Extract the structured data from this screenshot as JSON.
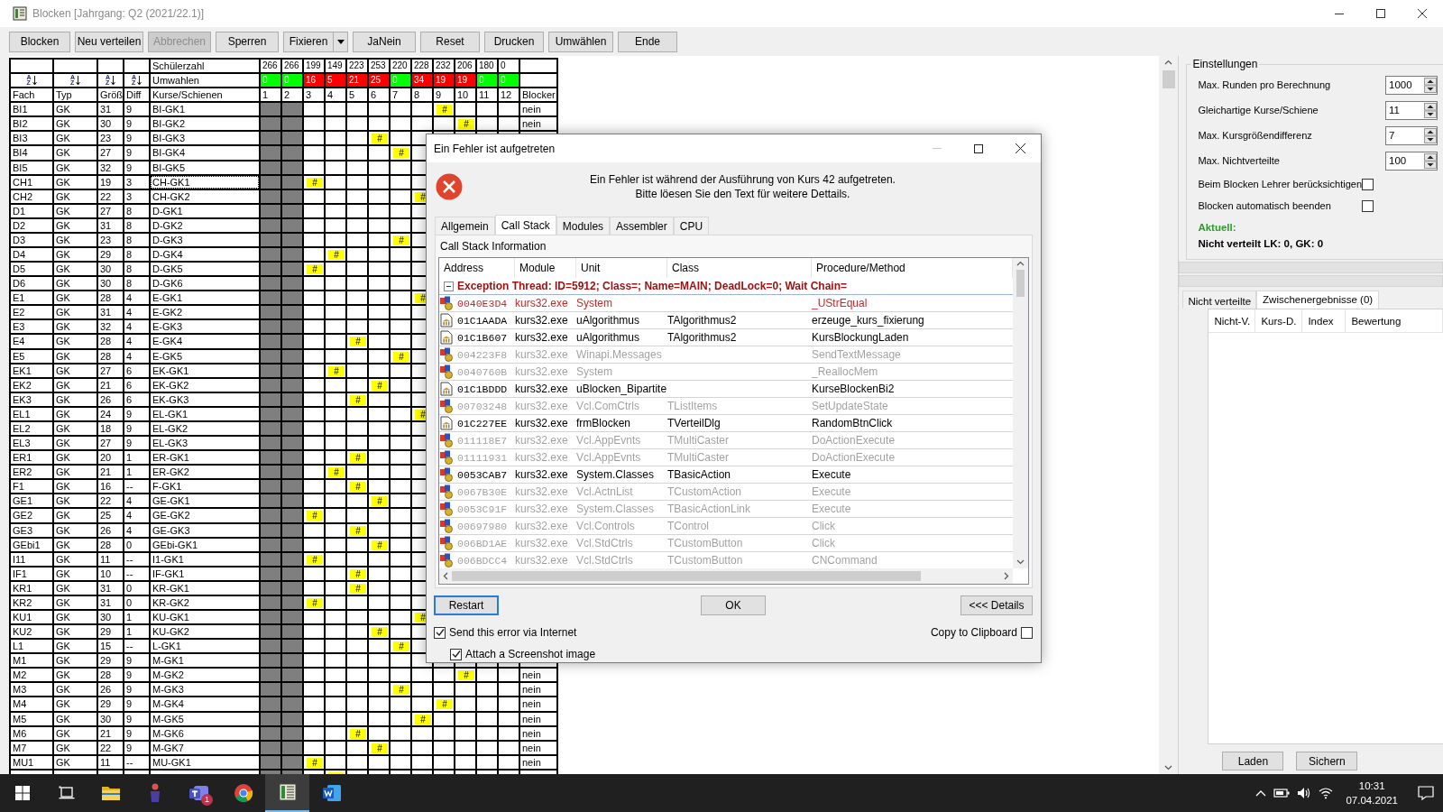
{
  "window": {
    "title": "Blocken [Jahrgang: Q2 (2021/22.1)]"
  },
  "toolbar": [
    {
      "label": "Blocken",
      "disabled": false,
      "kind": "plain"
    },
    {
      "label": "Neu verteilen",
      "disabled": false,
      "kind": "plain"
    },
    {
      "label": "Abbrechen",
      "disabled": true,
      "kind": "plain"
    },
    {
      "label": "Sperren",
      "disabled": false,
      "kind": "plain"
    },
    {
      "label": "Fixieren",
      "disabled": false,
      "kind": "split"
    },
    {
      "label": "JaNein",
      "disabled": false,
      "kind": "plain"
    },
    {
      "label": "Reset",
      "disabled": false,
      "kind": "plain"
    },
    {
      "label": "Drucken",
      "disabled": false,
      "kind": "plain"
    },
    {
      "label": "Umwählen",
      "disabled": false,
      "kind": "plain"
    },
    {
      "label": "Ende",
      "disabled": false,
      "kind": "plain"
    }
  ],
  "table": {
    "count_label": "Schülerzahl",
    "changes_label": "Umwahlen",
    "sort_buttons": [
      {
        "upper": "A",
        "lower": "Z"
      },
      {
        "upper": "A",
        "lower": "Z"
      },
      {
        "upper": "A",
        "lower": "Z"
      },
      {
        "upper": "A",
        "lower": "Z"
      }
    ],
    "headings": [
      "Fach",
      "Typ",
      "Größ",
      "Diff",
      "Kurse/Schienen"
    ],
    "blocker_heading": "Blocker",
    "columns": [
      {
        "label": "1",
        "count": "266",
        "changes": "0",
        "color": "#00ff00",
        "blocked": true
      },
      {
        "label": "2",
        "count": "266",
        "changes": "0",
        "color": "#00ff00",
        "blocked": true
      },
      {
        "label": "3",
        "count": "199",
        "changes": "16",
        "color": "#ff0000",
        "blocked": false
      },
      {
        "label": "4",
        "count": "149",
        "changes": "5",
        "color": "#ff0000",
        "blocked": false
      },
      {
        "label": "5",
        "count": "223",
        "changes": "21",
        "color": "#ff0000",
        "blocked": false
      },
      {
        "label": "6",
        "count": "253",
        "changes": "25",
        "color": "#ff0000",
        "blocked": false
      },
      {
        "label": "7",
        "count": "220",
        "changes": "0",
        "color": "#00ff00",
        "blocked": false
      },
      {
        "label": "8",
        "count": "228",
        "changes": "34",
        "color": "#ff0000",
        "blocked": false
      },
      {
        "label": "9",
        "count": "232",
        "changes": "19",
        "color": "#ff0000",
        "blocked": false
      },
      {
        "label": "10",
        "count": "206",
        "changes": "19",
        "color": "#ff0000",
        "blocked": false
      },
      {
        "label": "11",
        "count": "180",
        "changes": "0",
        "color": "#00ff00",
        "blocked": false
      },
      {
        "label": "12",
        "count": "0",
        "changes": "0",
        "color": "#00ff00",
        "blocked": false
      }
    ],
    "rows": [
      {
        "fach": "BI1",
        "typ": "GK",
        "size": "31",
        "diff": "9",
        "kurs": "BI-GK1",
        "focused": false,
        "placed": [
          false,
          false,
          false,
          false,
          false,
          false,
          false,
          false,
          true,
          false,
          false,
          false
        ],
        "mark": "#",
        "blocker": "nein"
      },
      {
        "fach": "BI2",
        "typ": "GK",
        "size": "30",
        "diff": "9",
        "kurs": "BI-GK2",
        "focused": false,
        "placed": [
          false,
          false,
          false,
          false,
          false,
          false,
          false,
          false,
          false,
          true,
          false,
          false
        ],
        "mark": "#",
        "blocker": "nein"
      },
      {
        "fach": "BI3",
        "typ": "GK",
        "size": "23",
        "diff": "9",
        "kurs": "BI-GK3",
        "focused": false,
        "placed": [
          false,
          false,
          false,
          false,
          false,
          true,
          false,
          false
        ],
        "mark": "#"
      },
      {
        "fach": "BI4",
        "typ": "GK",
        "size": "27",
        "diff": "9",
        "kurs": "BI-GK4",
        "focused": false,
        "placed": [
          false,
          false,
          false,
          false,
          false,
          false,
          true,
          false
        ],
        "mark": "#"
      },
      {
        "fach": "BI5",
        "typ": "GK",
        "size": "32",
        "diff": "9",
        "kurs": "BI-GK5",
        "focused": false,
        "placed": [
          false,
          false,
          false,
          false,
          false,
          false,
          false,
          false
        ]
      },
      {
        "fach": "CH1",
        "typ": "GK",
        "size": "19",
        "diff": "3",
        "kurs": "CH-GK1",
        "focused": true,
        "placed": [
          false,
          false,
          true,
          false,
          false,
          false,
          false,
          false
        ],
        "mark": "#"
      },
      {
        "fach": "CH2",
        "typ": "GK",
        "size": "22",
        "diff": "3",
        "kurs": "CH-GK2",
        "focused": false,
        "placed": [
          false,
          false,
          false,
          false,
          false,
          false,
          false,
          true
        ],
        "mark": "#"
      },
      {
        "fach": "D1",
        "typ": "GK",
        "size": "27",
        "diff": "8",
        "kurs": "D-GK1",
        "focused": false,
        "placed": [
          false,
          false,
          false,
          false,
          false,
          false,
          false,
          false
        ]
      },
      {
        "fach": "D2",
        "typ": "GK",
        "size": "31",
        "diff": "8",
        "kurs": "D-GK2",
        "focused": false,
        "placed": [
          false,
          false,
          false,
          false,
          false,
          false,
          false,
          false
        ]
      },
      {
        "fach": "D3",
        "typ": "GK",
        "size": "23",
        "diff": "8",
        "kurs": "D-GK3",
        "focused": false,
        "placed": [
          false,
          false,
          false,
          false,
          false,
          false,
          true,
          false
        ],
        "mark": "#"
      },
      {
        "fach": "D4",
        "typ": "GK",
        "size": "29",
        "diff": "8",
        "kurs": "D-GK4",
        "focused": false,
        "placed": [
          false,
          false,
          false,
          true,
          false,
          false,
          false,
          false
        ],
        "mark": "#"
      },
      {
        "fach": "D5",
        "typ": "GK",
        "size": "30",
        "diff": "8",
        "kurs": "D-GK5",
        "focused": false,
        "placed": [
          false,
          false,
          true,
          false,
          false,
          false,
          false,
          false
        ],
        "mark": "#"
      },
      {
        "fach": "D6",
        "typ": "GK",
        "size": "30",
        "diff": "8",
        "kurs": "D-GK6",
        "focused": false,
        "placed": [
          false,
          false,
          false,
          false,
          false,
          false,
          false,
          false
        ]
      },
      {
        "fach": "E1",
        "typ": "GK",
        "size": "28",
        "diff": "4",
        "kurs": "E-GK1",
        "focused": false,
        "placed": [
          false,
          false,
          false,
          false,
          false,
          false,
          false,
          true
        ],
        "mark": "#"
      },
      {
        "fach": "E2",
        "typ": "GK",
        "size": "31",
        "diff": "4",
        "kurs": "E-GK2",
        "focused": false,
        "placed": [
          false,
          false,
          false,
          false,
          false,
          false,
          false,
          false
        ]
      },
      {
        "fach": "E3",
        "typ": "GK",
        "size": "32",
        "diff": "4",
        "kurs": "E-GK3",
        "focused": false,
        "placed": [
          false,
          false,
          false,
          false,
          false,
          false,
          false,
          false
        ]
      },
      {
        "fach": "E4",
        "typ": "GK",
        "size": "28",
        "diff": "4",
        "kurs": "E-GK4",
        "focused": false,
        "placed": [
          false,
          false,
          false,
          false,
          true,
          false,
          false,
          false
        ],
        "mark": "#"
      },
      {
        "fach": "E5",
        "typ": "GK",
        "size": "28",
        "diff": "4",
        "kurs": "E-GK5",
        "focused": false,
        "placed": [
          false,
          false,
          false,
          false,
          false,
          false,
          true,
          false
        ],
        "mark": "#"
      },
      {
        "fach": "EK1",
        "typ": "GK",
        "size": "27",
        "diff": "6",
        "kurs": "EK-GK1",
        "focused": false,
        "placed": [
          false,
          false,
          false,
          true,
          false,
          false,
          false,
          false
        ],
        "mark": "#"
      },
      {
        "fach": "EK2",
        "typ": "GK",
        "size": "21",
        "diff": "6",
        "kurs": "EK-GK2",
        "focused": false,
        "placed": [
          false,
          false,
          false,
          false,
          false,
          true,
          false,
          false
        ],
        "mark": "#"
      },
      {
        "fach": "EK3",
        "typ": "GK",
        "size": "26",
        "diff": "6",
        "kurs": "EK-GK3",
        "focused": false,
        "placed": [
          false,
          false,
          false,
          false,
          true,
          false,
          false,
          false
        ],
        "mark": "#"
      },
      {
        "fach": "EL1",
        "typ": "GK",
        "size": "24",
        "diff": "9",
        "kurs": "EL-GK1",
        "focused": false,
        "placed": [
          false,
          false,
          false,
          false,
          false,
          false,
          false,
          true
        ],
        "mark": "#"
      },
      {
        "fach": "EL2",
        "typ": "GK",
        "size": "18",
        "diff": "9",
        "kurs": "EL-GK2",
        "focused": false,
        "placed": [
          false,
          false,
          false,
          false,
          false,
          false,
          false,
          false
        ]
      },
      {
        "fach": "EL3",
        "typ": "GK",
        "size": "27",
        "diff": "9",
        "kurs": "EL-GK3",
        "focused": false,
        "placed": [
          false,
          false,
          false,
          false,
          false,
          false,
          false,
          false
        ]
      },
      {
        "fach": "ER1",
        "typ": "GK",
        "size": "20",
        "diff": "1",
        "kurs": "ER-GK1",
        "focused": false,
        "placed": [
          false,
          false,
          false,
          false,
          true,
          false,
          false,
          false
        ],
        "mark": "#"
      },
      {
        "fach": "ER2",
        "typ": "GK",
        "size": "21",
        "diff": "1",
        "kurs": "ER-GK2",
        "focused": false,
        "placed": [
          false,
          false,
          false,
          true,
          false,
          false,
          false,
          false
        ],
        "mark": "#"
      },
      {
        "fach": "F1",
        "typ": "GK",
        "size": "16",
        "diff": "--",
        "kurs": "F-GK1",
        "focused": false,
        "placed": [
          false,
          false,
          false,
          false,
          true,
          false,
          false,
          false
        ],
        "mark": "#"
      },
      {
        "fach": "GE1",
        "typ": "GK",
        "size": "22",
        "diff": "4",
        "kurs": "GE-GK1",
        "focused": false,
        "placed": [
          false,
          false,
          false,
          false,
          false,
          true,
          false,
          false
        ],
        "mark": "#"
      },
      {
        "fach": "GE2",
        "typ": "GK",
        "size": "25",
        "diff": "4",
        "kurs": "GE-GK2",
        "focused": false,
        "placed": [
          false,
          false,
          true,
          false,
          false,
          false,
          false,
          false
        ],
        "mark": "#"
      },
      {
        "fach": "GE3",
        "typ": "GK",
        "size": "26",
        "diff": "4",
        "kurs": "GE-GK3",
        "focused": false,
        "placed": [
          false,
          false,
          false,
          false,
          true,
          false,
          false,
          false
        ],
        "mark": "#"
      },
      {
        "fach": "GEbi1",
        "typ": "GK",
        "size": "28",
        "diff": "0",
        "kurs": "GEbi-GK1",
        "focused": false,
        "placed": [
          false,
          false,
          false,
          false,
          false,
          true,
          false,
          false
        ],
        "mark": "#"
      },
      {
        "fach": "I11",
        "typ": "GK",
        "size": "11",
        "diff": "--",
        "kurs": "I1-GK1",
        "focused": false,
        "placed": [
          false,
          false,
          true,
          false,
          false,
          false,
          false,
          false
        ],
        "mark": "#"
      },
      {
        "fach": "IF1",
        "typ": "GK",
        "size": "10",
        "diff": "--",
        "kurs": "IF-GK1",
        "focused": false,
        "placed": [
          false,
          false,
          false,
          false,
          true,
          false,
          false,
          false
        ],
        "mark": "#"
      },
      {
        "fach": "KR1",
        "typ": "GK",
        "size": "31",
        "diff": "0",
        "kurs": "KR-GK1",
        "focused": false,
        "placed": [
          false,
          false,
          false,
          false,
          true,
          false,
          false,
          false
        ],
        "mark": "#"
      },
      {
        "fach": "KR2",
        "typ": "GK",
        "size": "31",
        "diff": "0",
        "kurs": "KR-GK2",
        "focused": false,
        "placed": [
          false,
          false,
          true,
          false,
          false,
          false,
          false,
          false
        ],
        "mark": "#"
      },
      {
        "fach": "KU1",
        "typ": "GK",
        "size": "30",
        "diff": "1",
        "kurs": "KU-GK1",
        "focused": false,
        "placed": [
          false,
          false,
          false,
          false,
          false,
          false,
          false,
          true
        ],
        "mark": "#"
      },
      {
        "fach": "KU2",
        "typ": "GK",
        "size": "29",
        "diff": "1",
        "kurs": "KU-GK2",
        "focused": false,
        "placed": [
          false,
          false,
          false,
          false,
          false,
          true,
          false,
          false
        ],
        "mark": "#"
      },
      {
        "fach": "L1",
        "typ": "GK",
        "size": "15",
        "diff": "--",
        "kurs": "L-GK1",
        "focused": false,
        "placed": [
          false,
          false,
          false,
          false,
          false,
          false,
          true,
          false
        ],
        "mark": "#"
      },
      {
        "fach": "M1",
        "typ": "GK",
        "size": "29",
        "diff": "9",
        "kurs": "M-GK1",
        "focused": false,
        "placed": [
          false,
          false,
          false,
          false,
          false,
          false,
          false,
          false
        ]
      },
      {
        "fach": "M2",
        "typ": "GK",
        "size": "28",
        "diff": "9",
        "kurs": "M-GK2",
        "focused": false,
        "placed": [
          false,
          false,
          false,
          false,
          false,
          false,
          false,
          false,
          false,
          true,
          false,
          false
        ],
        "mark": "#",
        "blocker": "nein"
      },
      {
        "fach": "M3",
        "typ": "GK",
        "size": "26",
        "diff": "9",
        "kurs": "M-GK3",
        "focused": false,
        "placed": [
          false,
          false,
          false,
          false,
          false,
          false,
          true,
          false,
          false,
          false,
          false,
          false
        ],
        "mark": "#",
        "blocker": "nein"
      },
      {
        "fach": "M4",
        "typ": "GK",
        "size": "29",
        "diff": "9",
        "kurs": "M-GK4",
        "focused": false,
        "placed": [
          false,
          false,
          false,
          false,
          false,
          false,
          false,
          false,
          true,
          false,
          false,
          false
        ],
        "mark": "#",
        "blocker": "nein"
      },
      {
        "fach": "M5",
        "typ": "GK",
        "size": "30",
        "diff": "9",
        "kurs": "M-GK5",
        "focused": false,
        "placed": [
          false,
          false,
          false,
          false,
          false,
          false,
          false,
          true,
          false,
          false,
          false,
          false
        ],
        "mark": "#",
        "blocker": "nein"
      },
      {
        "fach": "M6",
        "typ": "GK",
        "size": "21",
        "diff": "9",
        "kurs": "M-GK6",
        "focused": false,
        "placed": [
          false,
          false,
          false,
          false,
          true,
          false,
          false,
          false,
          false,
          false,
          false,
          false
        ],
        "mark": "#",
        "blocker": "nein"
      },
      {
        "fach": "M7",
        "typ": "GK",
        "size": "22",
        "diff": "9",
        "kurs": "M-GK7",
        "focused": false,
        "placed": [
          false,
          false,
          false,
          false,
          false,
          true,
          false,
          false,
          false,
          false,
          false,
          false
        ],
        "mark": "#",
        "blocker": "nein"
      },
      {
        "fach": "MU1",
        "typ": "GK",
        "size": "11",
        "diff": "--",
        "kurs": "MU-GK1",
        "focused": false,
        "placed": [
          false,
          false,
          true,
          false,
          false,
          false,
          false,
          false,
          false,
          false,
          false,
          false
        ],
        "mark": "#",
        "blocker": "nein"
      },
      {
        "focused": false,
        "placed": [
          false,
          false,
          false,
          true,
          false,
          false,
          false,
          false,
          false,
          false,
          false,
          false
        ]
      }
    ]
  },
  "dialog": {
    "title": "Ein Fehler ist aufgetreten",
    "message": [
      "Ein Fehler ist während der Ausführung von Kurs 42 aufgetreten.",
      "Bitte löesen Sie den Text für weitere Dettails."
    ],
    "tabs": [
      {
        "label": "Allgemein",
        "selected": false
      },
      {
        "label": "Call Stack",
        "selected": true
      },
      {
        "label": "Modules",
        "selected": false
      },
      {
        "label": "Assembler",
        "selected": false
      },
      {
        "label": "CPU",
        "selected": false
      }
    ],
    "section": "Call Stack Information",
    "columns": [
      "Address",
      "Module",
      "Unit",
      "Class",
      "Procedure/Method"
    ],
    "thread": {
      "text": "Exception Thread: ID=5912; Class=; Name=MAIN; DeadLock=0; Wait Chain=",
      "expanded": true
    },
    "frames": [
      {
        "kind": "library",
        "failed": true,
        "dimmed": false,
        "address": "0040E3D4",
        "module": "kurs32.exe",
        "unit": "System",
        "proc": "_UStrEqual"
      },
      {
        "kind": "source",
        "failed": false,
        "dimmed": false,
        "address": "01C1AADA",
        "module": "kurs32.exe",
        "unit": "uAlgorithmus",
        "class": "TAlgorithmus2",
        "proc": "erzeuge_kurs_fixierung"
      },
      {
        "kind": "source",
        "failed": false,
        "dimmed": false,
        "address": "01C1B607",
        "module": "kurs32.exe",
        "unit": "uAlgorithmus",
        "class": "TAlgorithmus2",
        "proc": "KursBlockungLaden"
      },
      {
        "kind": "library",
        "failed": false,
        "dimmed": true,
        "address": "004223F8",
        "module": "kurs32.exe",
        "unit": "Winapi.Messages",
        "proc": "SendTextMessage"
      },
      {
        "kind": "library",
        "failed": false,
        "dimmed": true,
        "address": "0040760B",
        "module": "kurs32.exe",
        "unit": "System",
        "proc": "_ReallocMem"
      },
      {
        "kind": "source",
        "failed": false,
        "dimmed": false,
        "address": "01C1BDDD",
        "module": "kurs32.exe",
        "unit": "uBlocken_Bipartite",
        "proc": "KurseBlockenBi2"
      },
      {
        "kind": "library",
        "failed": false,
        "dimmed": true,
        "address": "00703248",
        "module": "kurs32.exe",
        "unit": "Vcl.ComCtrls",
        "class": "TListItems",
        "proc": "SetUpdateState"
      },
      {
        "kind": "source",
        "failed": false,
        "dimmed": false,
        "address": "01C227EE",
        "module": "kurs32.exe",
        "unit": "frmBlocken",
        "class": "TVerteilDlg",
        "proc": "RandomBtnClick"
      },
      {
        "kind": "library",
        "failed": false,
        "dimmed": true,
        "address": "011118E7",
        "module": "kurs32.exe",
        "unit": "Vcl.AppEvnts",
        "class": "TMultiCaster",
        "proc": "DoActionExecute"
      },
      {
        "kind": "library",
        "failed": false,
        "dimmed": true,
        "address": "01111931",
        "module": "kurs32.exe",
        "unit": "Vcl.AppEvnts",
        "class": "TMultiCaster",
        "proc": "DoActionExecute"
      },
      {
        "kind": "library",
        "failed": false,
        "dimmed": false,
        "address": "0053CAB7",
        "module": "kurs32.exe",
        "unit": "System.Classes",
        "class": "TBasicAction",
        "proc": "Execute"
      },
      {
        "kind": "library",
        "failed": false,
        "dimmed": true,
        "address": "0067B30E",
        "module": "kurs32.exe",
        "unit": "Vcl.ActnList",
        "class": "TCustomAction",
        "proc": "Execute"
      },
      {
        "kind": "library",
        "failed": false,
        "dimmed": true,
        "address": "0053C91F",
        "module": "kurs32.exe",
        "unit": "System.Classes",
        "class": "TBasicActionLink",
        "proc": "Execute"
      },
      {
        "kind": "library",
        "failed": false,
        "dimmed": true,
        "address": "00697980",
        "module": "kurs32.exe",
        "unit": "Vcl.Controls",
        "class": "TControl",
        "proc": "Click"
      },
      {
        "kind": "library",
        "failed": false,
        "dimmed": true,
        "address": "006BD1AE",
        "module": "kurs32.exe",
        "unit": "Vcl.StdCtrls",
        "class": "TCustomButton",
        "proc": "Click"
      },
      {
        "kind": "library",
        "failed": false,
        "dimmed": true,
        "address": "006BDCC4",
        "module": "kurs32.exe",
        "unit": "Vcl.StdCtrls",
        "class": "TCustomButton",
        "proc": "CNCommand"
      }
    ],
    "buttons": [
      {
        "label": "Restart",
        "focused": true
      },
      {
        "label": "OK",
        "focused": false
      },
      {
        "label": "<<< Details",
        "focused": false
      }
    ],
    "checks": [
      {
        "kind": "left",
        "label": "Send this error via Internet",
        "checked": true
      },
      {
        "kind": "right",
        "label": "Copy to Clipboard",
        "checked": false
      },
      {
        "kind": "indented",
        "label": "Attach a Screenshot image",
        "checked": true
      }
    ]
  },
  "settings": {
    "title": "Einstellungen",
    "items": [
      {
        "kind": "spin",
        "label": "Max. Runden pro Berechnung",
        "value": "1000"
      },
      {
        "kind": "spin",
        "label": "Gleichartige Kurse/Schiene",
        "value": "11"
      },
      {
        "kind": "spin",
        "label": "Max. Kursgrößendifferenz",
        "value": "7"
      },
      {
        "kind": "spin",
        "label": "Max. Nichtverteilte",
        "value": "100"
      },
      {
        "kind": "check",
        "label": "Beim Blocken Lehrer berücksichtigen",
        "checked": false
      },
      {
        "kind": "check",
        "label": "Blocken automatisch beenden",
        "checked": false
      }
    ],
    "status_heading": "Aktuell:",
    "status_text": "Nicht verteilt LK: 0, GK: 0"
  },
  "results": {
    "tabs": [
      {
        "label": "Nicht verteilte",
        "selected": false
      },
      {
        "label": "Zwischenergebnisse (0)",
        "selected": true
      }
    ],
    "columns": [
      "Nicht-V.",
      "Kurs-D.",
      "Index",
      "Bewertung"
    ],
    "buttons": [
      "Laden",
      "Sichern"
    ]
  },
  "taskbar": {
    "apps": [
      {
        "kind": "start",
        "active": false
      },
      {
        "kind": "taskview",
        "active": false
      },
      {
        "kind": "folder",
        "active": false
      },
      {
        "kind": "figure",
        "active": false
      },
      {
        "kind": "chat",
        "active": false,
        "badge": "1"
      },
      {
        "kind": "browser",
        "active": false
      },
      {
        "kind": "grid",
        "active": true
      },
      {
        "kind": "doc",
        "active": false
      }
    ],
    "tray": [
      {
        "kind": "chevron"
      },
      {
        "kind": "battery"
      },
      {
        "kind": "speaker"
      },
      {
        "kind": "wifi"
      }
    ],
    "time": "10:31",
    "date": "07.04.2021"
  }
}
